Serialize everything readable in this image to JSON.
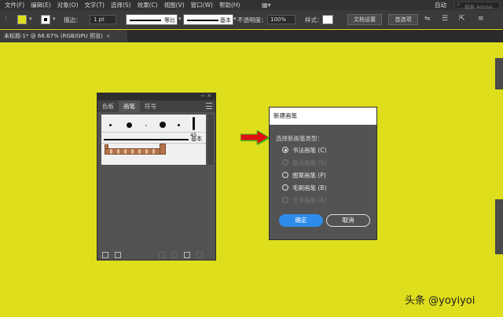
{
  "menubar": {
    "items": [
      "文件(F)",
      "编辑(E)",
      "对象(O)",
      "文字(T)",
      "选择(S)",
      "效果(C)",
      "视图(V)",
      "窗口(W)",
      "帮助(H)"
    ],
    "workspace": "自动",
    "search_placeholder": "搜索 Adobe Stock"
  },
  "controlbar": {
    "stroke_label": "描边：",
    "stroke_weight": "1 pt",
    "stroke_profile": "等比",
    "brush_definition": "基本",
    "opacity_label": "不透明度：",
    "opacity_value": "100%",
    "style_label": "样式：",
    "doc_setup": "文档设置",
    "preferences": "首选项",
    "fill_color": "#dede1c"
  },
  "document_tab": {
    "title": "未标题-1* @ 66.67% (RGB/GPU 预览)",
    "close": "×"
  },
  "brush_panel": {
    "collapse": "‹‹ ×",
    "tabs": [
      "色板",
      "画笔",
      "符号"
    ],
    "active_tab": 1,
    "calligraphic_size": "45",
    "basic_label": "基本"
  },
  "dialog": {
    "title": "新建画笔",
    "prompt": "选择新画笔类型：",
    "options": [
      {
        "label": "书法画笔 (C)",
        "checked": true,
        "enabled": true
      },
      {
        "label": "散点画笔 (S)",
        "checked": false,
        "enabled": false
      },
      {
        "label": "图案画笔 (P)",
        "checked": false,
        "enabled": true
      },
      {
        "label": "毛刷画笔 (B)",
        "checked": false,
        "enabled": true
      },
      {
        "label": "艺术画笔 (A)",
        "checked": false,
        "enabled": false
      }
    ],
    "ok": "确定",
    "cancel": "取消"
  },
  "watermark": "头条 @yoyiyoi",
  "colors": {
    "canvas": "#dede1c",
    "accent_button": "#2d8ceb",
    "arrow_red": "#e01010",
    "arrow_green": "#3fbf1f"
  }
}
